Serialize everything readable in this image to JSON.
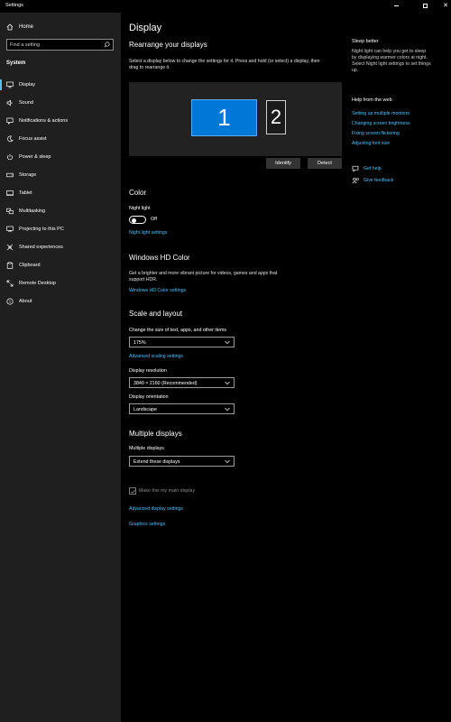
{
  "window": {
    "title": "Settings"
  },
  "sidebar": {
    "home_label": "Home",
    "search_placeholder": "Find a setting",
    "section_label": "System",
    "items": [
      {
        "label": "Display",
        "icon": "monitor-icon",
        "active": true
      },
      {
        "label": "Sound",
        "icon": "speaker-icon"
      },
      {
        "label": "Notifications & actions",
        "icon": "notification-icon"
      },
      {
        "label": "Focus assist",
        "icon": "moon-icon"
      },
      {
        "label": "Power & sleep",
        "icon": "power-icon"
      },
      {
        "label": "Storage",
        "icon": "storage-icon"
      },
      {
        "label": "Tablet",
        "icon": "tablet-icon"
      },
      {
        "label": "Multitasking",
        "icon": "multitasking-icon"
      },
      {
        "label": "Projecting to this PC",
        "icon": "projecting-icon"
      },
      {
        "label": "Shared experiences",
        "icon": "shared-experiences-icon"
      },
      {
        "label": "Clipboard",
        "icon": "clipboard-icon"
      },
      {
        "label": "Remote Desktop",
        "icon": "remote-desktop-icon"
      },
      {
        "label": "About",
        "icon": "info-icon"
      }
    ]
  },
  "main": {
    "title": "Display",
    "rearrange": {
      "heading": "Rearrange your displays",
      "description_line1": "Select a display below to change the settings for it. Press and hold (or select) a display, then",
      "description_line2": "drag to rearrange it.",
      "monitor1": "1",
      "monitor2": "2",
      "identify_button": "Identify",
      "detect_button": "Detect"
    },
    "color": {
      "heading": "Color",
      "night_light_label": "Night light",
      "night_light_state": "Off",
      "night_light_on": false,
      "night_light_settings_link": "Night light settings"
    },
    "hdr": {
      "heading": "Windows HD Color",
      "description_line1": "Get a brighter and more vibrant picture for videos, games and apps that",
      "description_line2": "support HDR.",
      "settings_link": "Windows HD Color settings"
    },
    "scale": {
      "heading": "Scale and layout",
      "size_label": "Change the size of text, apps, and other items",
      "size_value": "175%",
      "advanced_scaling_link": "Advanced scaling settings",
      "resolution_label": "Display resolution",
      "resolution_value": "3840 × 2160 (Recommended)",
      "orientation_label": "Display orientation",
      "orientation_value": "Landscape"
    },
    "multiple": {
      "heading": "Multiple displays",
      "label": "Multiple displays",
      "value": "Extend these displays",
      "main_display_checkbox": "Make this my main display",
      "main_display_checked": true,
      "advanced_display_link": "Advanced display settings",
      "graphics_link": "Graphics settings"
    }
  },
  "right_panel": {
    "sleep_better_title": "Sleep better",
    "sleep_better_line1": "Night light can help you get to sleep",
    "sleep_better_line2": "by displaying warmer colors at night.",
    "sleep_better_line3": "Select Night light settings to set things",
    "sleep_better_line4": "up.",
    "help_title": "Help from the web",
    "help_links": [
      "Setting up multiple monitors",
      "Changing screen brightness",
      "Fixing screen flickering",
      "Adjusting font size"
    ],
    "get_help_link": "Get help",
    "give_feedback_link": "Give feedback"
  },
  "colors": {
    "accent": "#0078d7",
    "link": "#4cc2ff",
    "sidebar_bg": "#1f1f1f",
    "main_bg": "#000000"
  }
}
